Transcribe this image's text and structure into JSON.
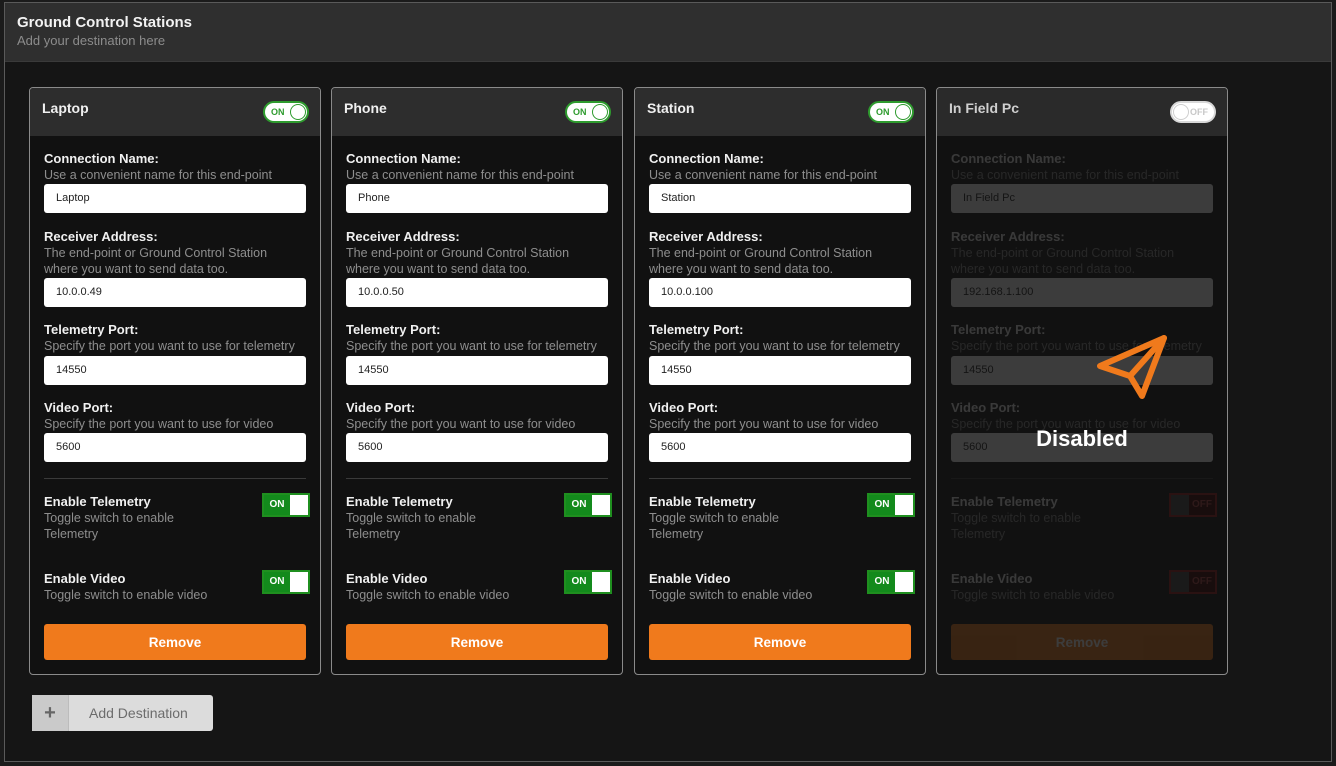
{
  "panel": {
    "title": "Ground Control Stations",
    "subtitle": "Add your destination here"
  },
  "labels": {
    "connection_name": "Connection Name:",
    "connection_name_help": "Use a convenient name for this end-point",
    "receiver_address": "Receiver Address:",
    "receiver_address_help": "The end-point or Ground Control Station where you want to send data too.",
    "telemetry_port": "Telemetry Port:",
    "telemetry_port_help": "Specify the port you want to use for telemetry",
    "video_port": "Video Port:",
    "video_port_help": "Specify the port you want to use for video",
    "enable_telemetry": "Enable Telemetry",
    "enable_telemetry_help": "Toggle switch to enable Telemetry",
    "enable_video": "Enable Video",
    "enable_video_help": "Toggle switch to enable video",
    "remove": "Remove",
    "on": "ON",
    "off": "OFF",
    "disabled": "Disabled"
  },
  "cards": [
    {
      "title": "Laptop",
      "enabled": "ON",
      "connection_name": "Laptop",
      "receiver_address": "10.0.0.49",
      "telemetry_port": "14550",
      "video_port": "5600",
      "telemetry": "ON",
      "video": "ON"
    },
    {
      "title": "Phone",
      "enabled": "ON",
      "connection_name": "Phone",
      "receiver_address": "10.0.0.50",
      "telemetry_port": "14550",
      "video_port": "5600",
      "telemetry": "ON",
      "video": "ON"
    },
    {
      "title": "Station",
      "enabled": "ON",
      "connection_name": "Station",
      "receiver_address": "10.0.0.100",
      "telemetry_port": "14550",
      "video_port": "5600",
      "telemetry": "ON",
      "video": "ON"
    },
    {
      "title": "In Field Pc",
      "enabled": "OFF",
      "connection_name": "In Field Pc",
      "receiver_address": "192.168.1.100",
      "telemetry_port": "14550",
      "video_port": "5600",
      "telemetry": "OFF",
      "video": "OFF"
    }
  ],
  "add_button": {
    "icon": "plus-icon",
    "label": "Add Destination"
  },
  "colors": {
    "accent": "#f07a1c",
    "on": "#138a1c",
    "off": "#9a1818"
  }
}
